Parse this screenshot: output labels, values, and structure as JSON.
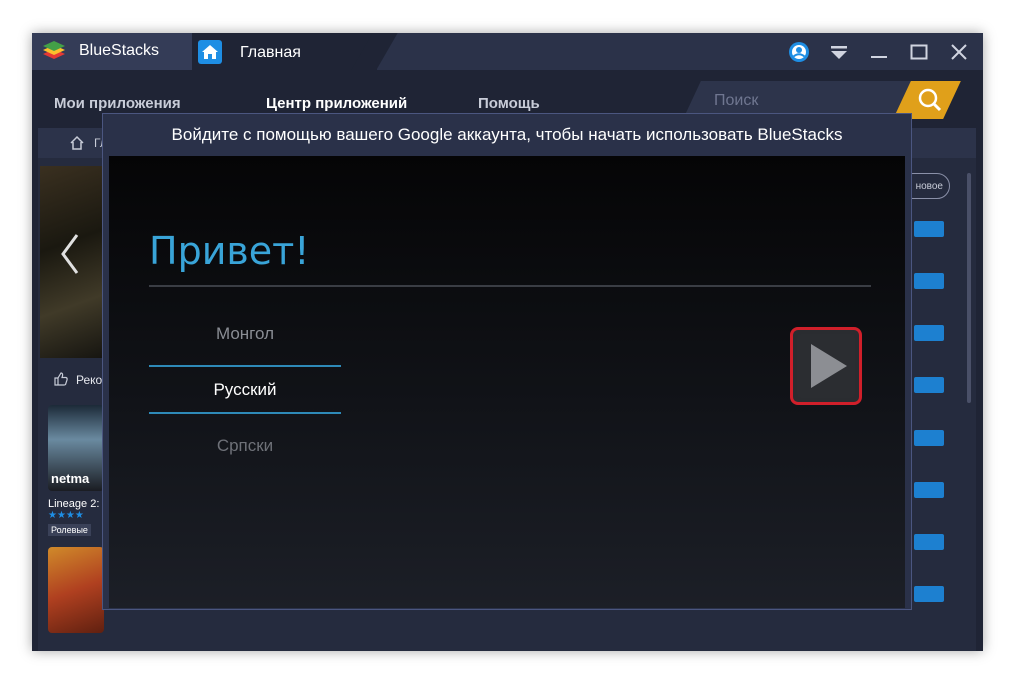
{
  "titlebar": {
    "app_name": "BlueStacks",
    "home_tab_title": "Главная"
  },
  "nav": {
    "items": [
      "Мои приложения",
      "Центр приложений",
      "Помощь"
    ],
    "search_placeholder": "Поиск"
  },
  "background": {
    "breadcrumb_label": "Гл",
    "recommended_label": "Реко",
    "new_pill": "новое",
    "app_name": "Lineage 2:",
    "app_tile_text": "netma",
    "app_genre": "Ролевые"
  },
  "dialog": {
    "header": "Войдите с помощью вашего Google аккаунта, чтобы начать использовать BlueStacks",
    "greeting": "Привет!",
    "languages": {
      "prev": "Монгол",
      "selected": "Русский",
      "next": "Српски"
    }
  },
  "colors": {
    "accent_blue": "#39a4d8",
    "highlight_red": "#d01f2a",
    "search_button": "#e0a01a"
  }
}
